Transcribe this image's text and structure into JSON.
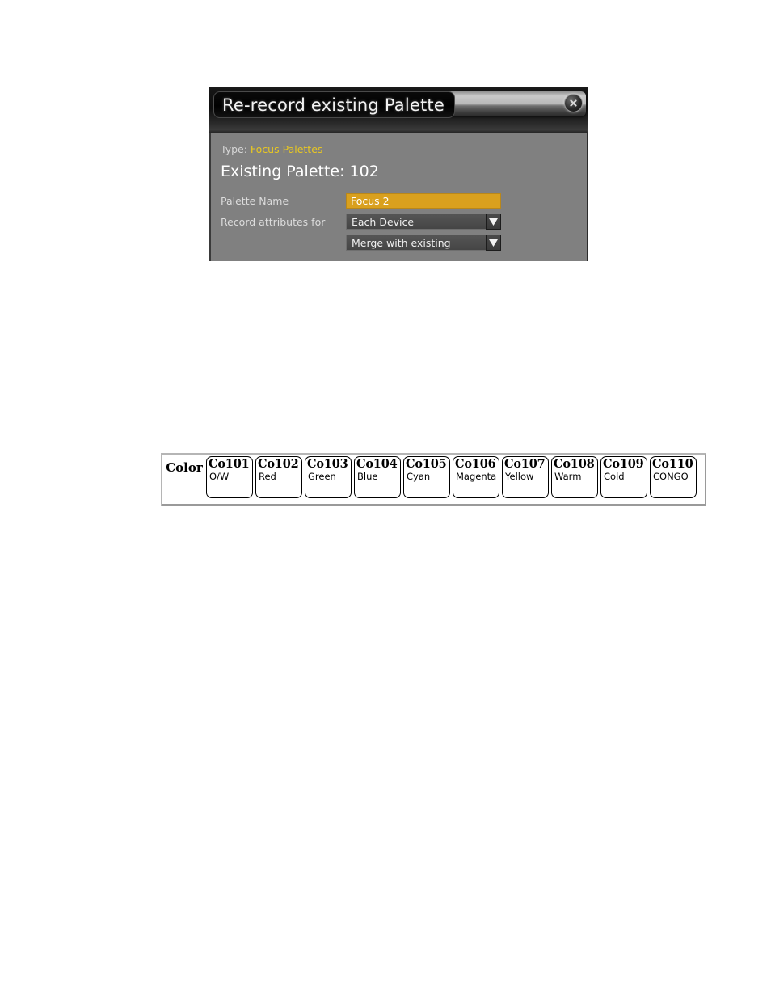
{
  "dialog": {
    "title": "Re-record existing Palette",
    "close_icon": "close-circle-icon",
    "type_label": "Type:",
    "type_value": "Focus Palettes",
    "existing_palette": "Existing Palette: 102",
    "fields": {
      "palette_name_label": "Palette Name",
      "palette_name_value": "Focus 2",
      "record_attributes_label": "Record attributes for",
      "record_attributes_value": "Each Device",
      "merge_mode_value": "Merge with existing"
    },
    "colors": {
      "body_bg": "#808080",
      "field_accent": "#D9A01E",
      "type_value_color": "#E8C722",
      "title_text": "#F2F2F2"
    }
  },
  "palette_table": {
    "row_label": "Color",
    "cells": [
      {
        "id": "Co101",
        "name": "O/W"
      },
      {
        "id": "Co102",
        "name": "Red"
      },
      {
        "id": "Co103",
        "name": "Green"
      },
      {
        "id": "Co104",
        "name": "Blue"
      },
      {
        "id": "Co105",
        "name": "Cyan"
      },
      {
        "id": "Co106",
        "name": "Magenta"
      },
      {
        "id": "Co107",
        "name": "Yellow"
      },
      {
        "id": "Co108",
        "name": "Warm"
      },
      {
        "id": "Co109",
        "name": "Cold"
      },
      {
        "id": "Co110",
        "name": "CONGO"
      }
    ]
  }
}
